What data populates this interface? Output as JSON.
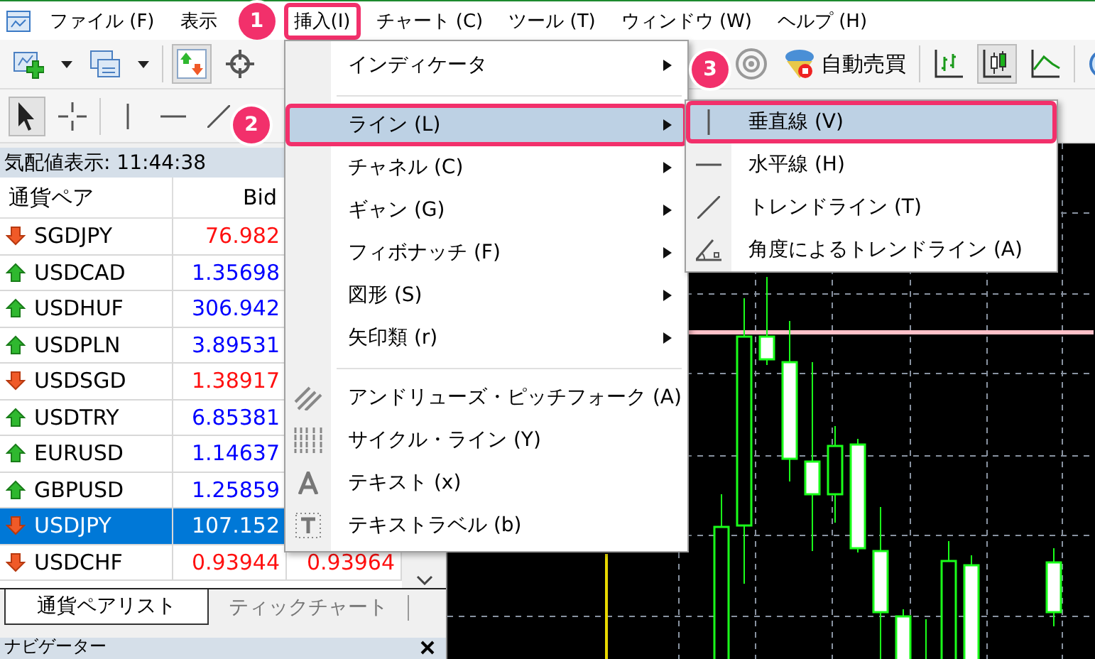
{
  "menubar": {
    "items": [
      {
        "label": "ファイル (F)",
        "selected": false
      },
      {
        "label": "表示",
        "selected": false
      },
      {
        "label": "挿入(I)",
        "selected": true,
        "callout": "1"
      },
      {
        "label": "チャート (C)",
        "selected": false
      },
      {
        "label": "ツール (T)",
        "selected": false
      },
      {
        "label": "ウィンドウ (W)",
        "selected": false
      },
      {
        "label": "ヘルプ (H)",
        "selected": false
      }
    ]
  },
  "toolbar_1": {
    "left": [
      {
        "kind": "new-chart",
        "selected": false
      },
      {
        "kind": "caret",
        "selected": false
      },
      {
        "kind": "profiles",
        "selected": false
      },
      {
        "kind": "caret",
        "selected": false
      },
      {
        "kind": "separator"
      },
      {
        "kind": "market-watch",
        "selected": true
      },
      {
        "kind": "crosshair",
        "selected": false
      }
    ],
    "right": [
      {
        "kind": "signals",
        "selected": false
      },
      {
        "kind": "auto-trading",
        "label": "自動売買",
        "selected": false
      },
      {
        "kind": "separator"
      },
      {
        "kind": "bar-chart",
        "selected": false
      },
      {
        "kind": "candlesticks",
        "selected": true
      },
      {
        "kind": "line-chart",
        "selected": false
      },
      {
        "kind": "separator"
      },
      {
        "kind": "zoom-in",
        "selected": false
      }
    ]
  },
  "toolbar_2": {
    "left": [
      {
        "kind": "cursor",
        "selected": true
      },
      {
        "kind": "crosshair-lines",
        "selected": false
      },
      {
        "kind": "separator"
      },
      {
        "kind": "vertical-line",
        "selected": false
      },
      {
        "kind": "horizontal-line",
        "selected": false
      },
      {
        "kind": "trendline",
        "selected": false
      }
    ]
  },
  "insert_menu": {
    "items": [
      {
        "kind": "plain",
        "label": "インディケータ",
        "submenu": true,
        "selected": false
      },
      {
        "kind": "separator"
      },
      {
        "kind": "plain",
        "label": "ライン (L)",
        "submenu": true,
        "selected": true,
        "callout": "2"
      },
      {
        "kind": "plain",
        "label": "チャネル (C)",
        "submenu": true,
        "selected": false
      },
      {
        "kind": "plain",
        "label": "ギャン (G)",
        "submenu": true,
        "selected": false
      },
      {
        "kind": "plain",
        "label": "フィボナッチ (F)",
        "submenu": true,
        "selected": false
      },
      {
        "kind": "plain",
        "label": "図形 (S)",
        "submenu": true,
        "selected": false
      },
      {
        "kind": "plain",
        "label": "矢印類 (r)",
        "submenu": true,
        "selected": false
      },
      {
        "kind": "separator"
      },
      {
        "kind": "pitchfork",
        "label": "アンドリューズ・ピッチフォーク (A)",
        "submenu": false,
        "selected": false
      },
      {
        "kind": "cycle-lines",
        "label": "サイクル・ライン (Y)",
        "submenu": false,
        "selected": false
      },
      {
        "kind": "text",
        "label": "テキスト (x)",
        "submenu": false,
        "selected": false
      },
      {
        "kind": "text-label",
        "label": "テキストラベル (b)",
        "submenu": false,
        "selected": false
      }
    ]
  },
  "line_submenu": {
    "items": [
      {
        "kind": "vertical-line",
        "label": "垂直線 (V)",
        "selected": true,
        "callout": "3"
      },
      {
        "kind": "horizontal-line",
        "label": "水平線 (H)",
        "selected": false
      },
      {
        "kind": "trendline",
        "label": "トレンドライン (T)",
        "selected": false
      },
      {
        "kind": "angle-trendline",
        "label": "角度によるトレンドライン (A)",
        "selected": false
      }
    ]
  },
  "market_watch": {
    "title": "気配値表示: 11:44:38",
    "columns": [
      "通貨ペア",
      "Bid"
    ],
    "rows": [
      {
        "kind": "down",
        "symbol": "SGDJPY",
        "bid": "76.982",
        "selected": false
      },
      {
        "kind": "up",
        "symbol": "USDCAD",
        "bid": "1.35698",
        "selected": false
      },
      {
        "kind": "up",
        "symbol": "USDHUF",
        "bid": "306.942",
        "selected": false
      },
      {
        "kind": "up",
        "symbol": "USDPLN",
        "bid": "3.89531",
        "selected": false
      },
      {
        "kind": "down",
        "symbol": "USDSGD",
        "bid": "1.38917",
        "selected": false
      },
      {
        "kind": "up",
        "symbol": "USDTRY",
        "bid": "6.85381",
        "selected": false
      },
      {
        "kind": "up",
        "symbol": "EURUSD",
        "bid": "1.14637",
        "selected": false
      },
      {
        "kind": "up",
        "symbol": "GBPUSD",
        "bid": "1.25859",
        "selected": false
      },
      {
        "kind": "down",
        "symbol": "USDJPY",
        "bid": "107.152",
        "selected": true
      },
      {
        "kind": "down",
        "symbol": "USDCHF",
        "bid": "0.93944",
        "ask": "0.93964",
        "selected": false
      }
    ],
    "tabs": [
      {
        "label": "通貨ペアリスト",
        "selected": true
      },
      {
        "label": "ティックチャート",
        "selected": false
      }
    ]
  },
  "navigator": {
    "title": "ナビゲーター"
  }
}
